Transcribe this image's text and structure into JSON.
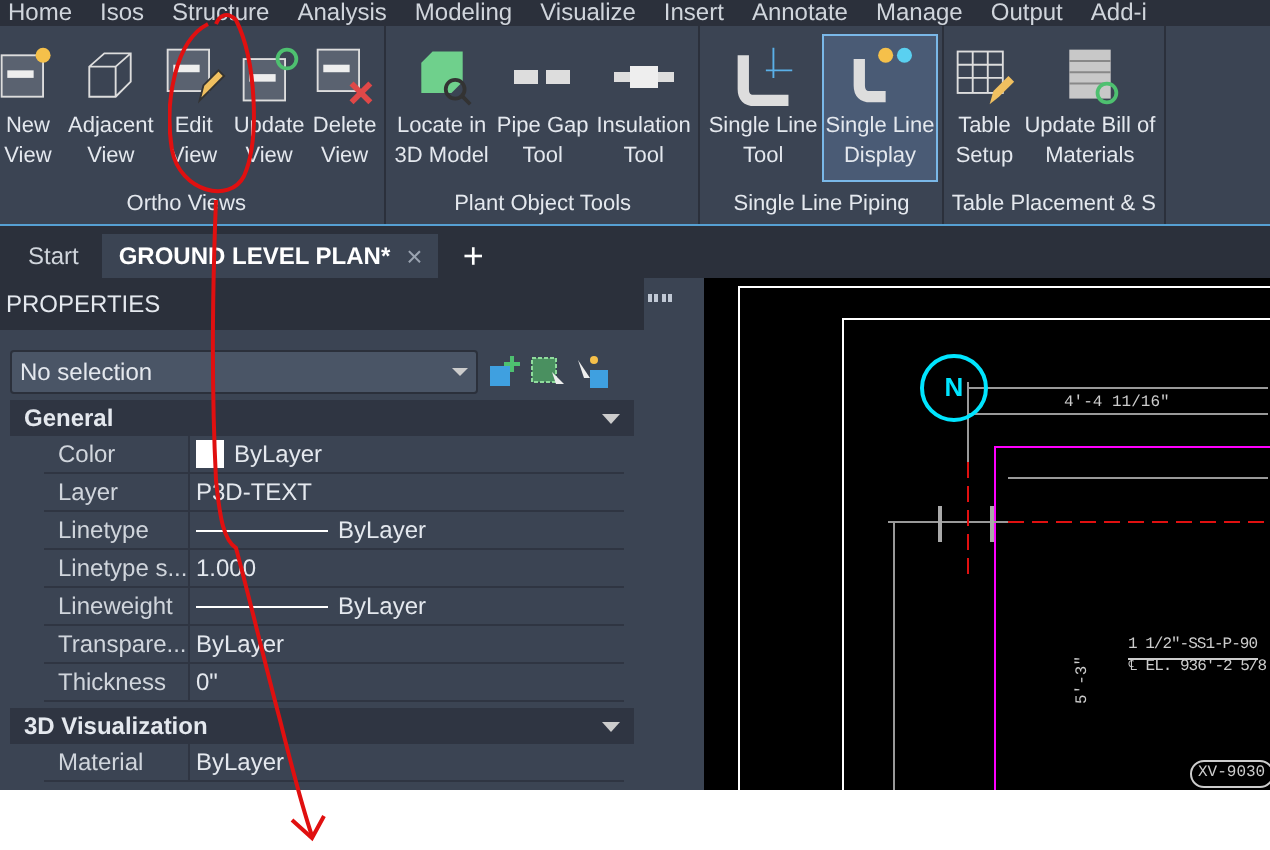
{
  "menu_tabs": [
    "Home",
    "Isos",
    "Structure",
    "Analysis",
    "Modeling",
    "Visualize",
    "Insert",
    "Annotate",
    "Manage",
    "Output",
    "Add-i"
  ],
  "ribbon": {
    "panels": [
      {
        "title": "Ortho Views",
        "buttons": [
          {
            "lines": [
              "New",
              "View"
            ],
            "selected": false
          },
          {
            "lines": [
              "Adjacent",
              "View"
            ],
            "selected": false
          },
          {
            "lines": [
              "Edit",
              "View"
            ],
            "selected": false
          },
          {
            "lines": [
              "Update",
              "View"
            ],
            "selected": false
          },
          {
            "lines": [
              "Delete",
              "View"
            ],
            "selected": false
          }
        ]
      },
      {
        "title": "Plant Object Tools",
        "buttons": [
          {
            "lines": [
              "Locate in",
              "3D Model"
            ],
            "selected": false
          },
          {
            "lines": [
              "Pipe Gap",
              "Tool"
            ],
            "selected": false
          },
          {
            "lines": [
              "Insulation",
              "Tool"
            ],
            "selected": false
          }
        ]
      },
      {
        "title": "Single Line Piping",
        "buttons": [
          {
            "lines": [
              "Single Line",
              "Tool"
            ],
            "selected": false
          },
          {
            "lines": [
              "Single Line",
              "Display"
            ],
            "selected": true
          }
        ]
      },
      {
        "title": "Table Placement & S",
        "buttons": [
          {
            "lines": [
              "Table",
              "Setup"
            ],
            "selected": false
          },
          {
            "lines": [
              "Update Bill of",
              "Materials"
            ],
            "selected": false
          }
        ]
      }
    ]
  },
  "document_tabs": [
    {
      "label": "Start",
      "selected": false
    },
    {
      "label": "GROUND LEVEL PLAN*",
      "selected": true,
      "close": "×"
    }
  ],
  "new_tab": "+",
  "properties": {
    "title": "PROPERTIES",
    "selector": "No selection",
    "sections": [
      {
        "title": "General",
        "expanded": true,
        "rows": [
          {
            "kind": "color",
            "label": "Color",
            "value": "ByLayer"
          },
          {
            "kind": "text",
            "label": "Layer",
            "value": "P3D-TEXT"
          },
          {
            "kind": "line",
            "label": "Linetype",
            "value": "ByLayer"
          },
          {
            "kind": "text",
            "label": "Linetype s...",
            "value": "1.000"
          },
          {
            "kind": "line",
            "label": "Lineweight",
            "value": "ByLayer"
          },
          {
            "kind": "text",
            "label": "Transpare...",
            "value": "ByLayer"
          },
          {
            "kind": "text",
            "label": "Thickness",
            "value": "0\""
          }
        ]
      },
      {
        "title": "3D Visualization",
        "expanded": true,
        "rows": [
          {
            "kind": "text",
            "label": "Material",
            "value": "ByLayer"
          }
        ]
      }
    ]
  },
  "drawing": {
    "north_label": "N",
    "dimension": "4'-4 11/16\"",
    "pipe_label": "1 1/2\"-SS1-P-90",
    "elevation": "℄ EL. 936'-2 5/8",
    "vertical_dimension": "5'-3\"",
    "valve_tag": "XV-9030"
  }
}
